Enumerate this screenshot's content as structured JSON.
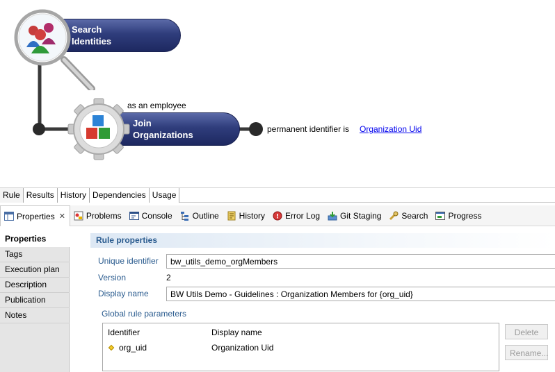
{
  "diagram": {
    "search_node": {
      "line1": "Search",
      "line2": "Identities"
    },
    "join_node": {
      "line1": "Join",
      "line2": "Organizations"
    },
    "join_caption": "as an employee",
    "output_label": "permanent identifier is",
    "output_link": "Organization Uid"
  },
  "editor_tabs": [
    "Rule",
    "Results",
    "History",
    "Dependencies",
    "Usage"
  ],
  "view_tabs": {
    "properties": "Properties",
    "problems": "Problems",
    "console": "Console",
    "outline": "Outline",
    "history": "History",
    "error_log": "Error Log",
    "git_staging": "Git Staging",
    "search": "Search",
    "progress": "Progress"
  },
  "prop_nav": [
    "Properties",
    "Tags",
    "Execution plan",
    "Description",
    "Publication",
    "Notes"
  ],
  "rule_properties": {
    "title": "Rule properties",
    "unique_identifier_label": "Unique identifier",
    "unique_identifier_value": "bw_utils_demo_orgMembers",
    "version_label": "Version",
    "version_value": "2",
    "display_name_label": "Display name",
    "display_name_value": "BW Utils Demo - Guidelines : Organization Members for {org_uid}"
  },
  "global_params": {
    "title": "Global rule parameters",
    "columns": [
      "Identifier",
      "Display name"
    ],
    "rows": [
      {
        "identifier": "org_uid",
        "display_name": "Organization Uid"
      }
    ],
    "delete_button": "Delete",
    "rename_button": "Rename..."
  }
}
